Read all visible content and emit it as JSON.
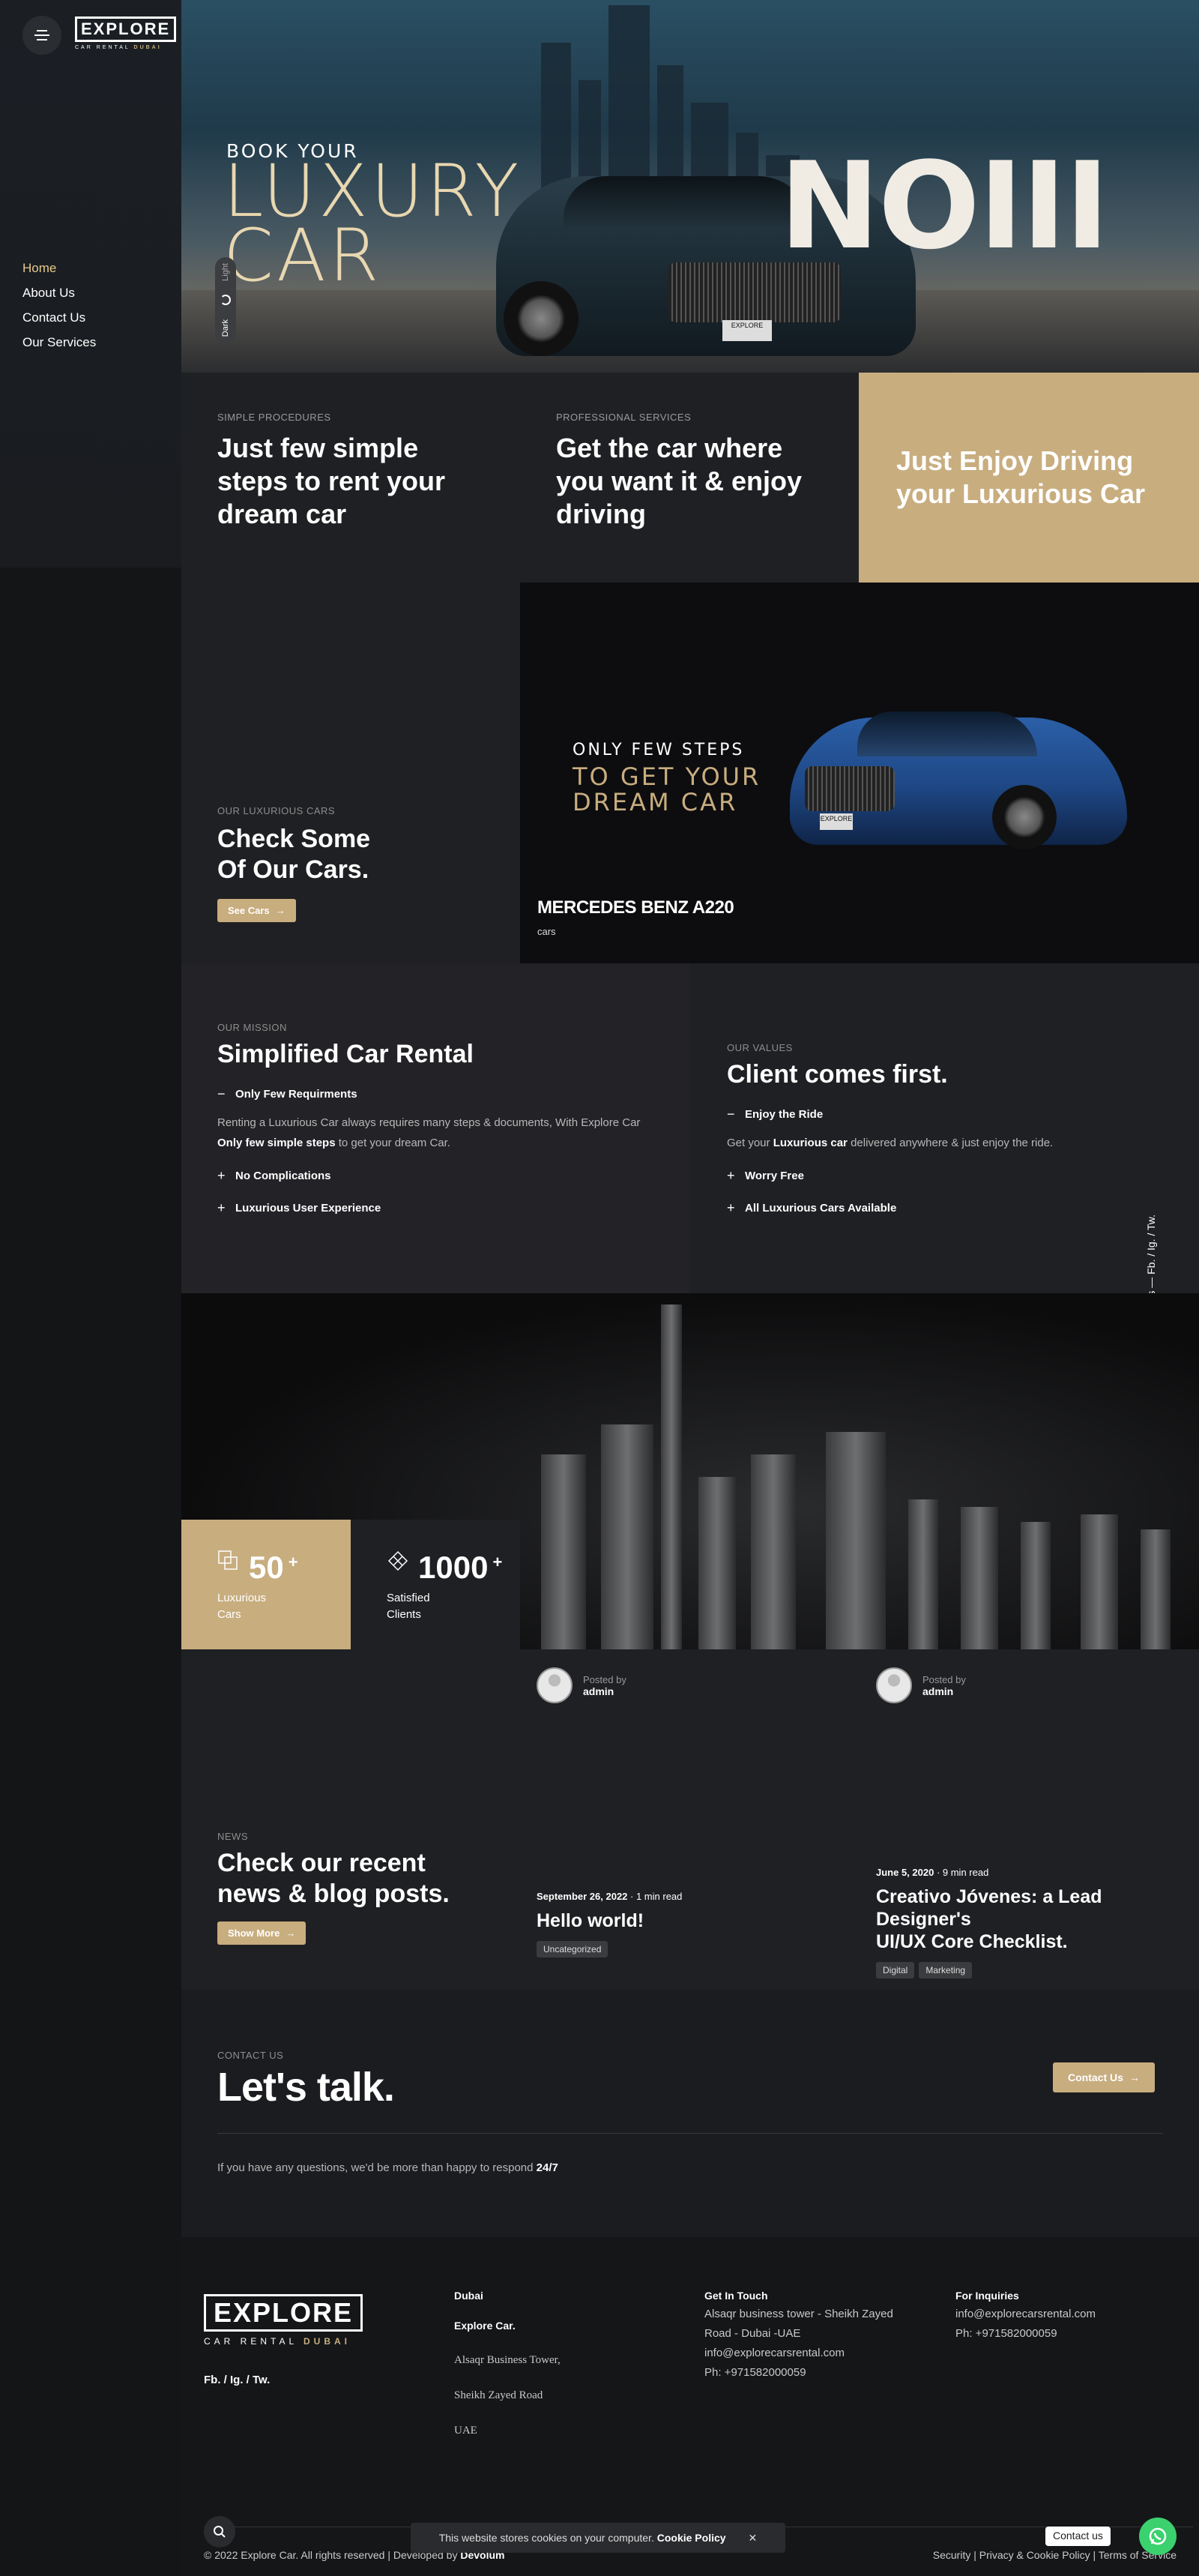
{
  "brand": {
    "logo": "EXPLORE",
    "tagline_prefix": "CAR RENTAL ",
    "tagline_city": "DUBAI"
  },
  "nav": [
    "Home",
    "About Us",
    "Contact Us",
    "Our Services"
  ],
  "mode_toggle": {
    "dark": "Dark",
    "light": "Light"
  },
  "hero": {
    "eyebrow": "BOOK YOUR",
    "title_line1": "LUXURY",
    "title_line2": "CAR",
    "model": "NOIII",
    "plate": "EXPLORE"
  },
  "steps": [
    {
      "eyebrow": "SIMPLE PROCEDURES",
      "title": "Just few simple steps to rent your dream car"
    },
    {
      "eyebrow": "PROFESSIONAL SERVICES",
      "title": "Get the car where you want it & enjoy driving"
    }
  ],
  "gold_cta": "Just Enjoy Driving your Luxurious Car",
  "cars": {
    "eyebrow": "OUR LUXURIOUS CARS",
    "title_line1": "Check Some",
    "title_line2": "Of Our Cars.",
    "button": "See Cars",
    "promo_small": "ONLY FEW STEPS",
    "promo_line1": "TO GET YOUR",
    "promo_line2": "DREAM CAR",
    "car_name": "MERCEDES BENZ A220",
    "car_category": "cars"
  },
  "mission": {
    "eyebrow": "OUR MISSION",
    "title": "Simplified Car Rental",
    "open_item": "Only Few Requirments",
    "para_1": "Renting a Luxurious Car always requires many steps & documents, With Explore Car ",
    "para_bold": "Only few simple steps",
    "para_2": " to get your dream Car.",
    "items": [
      "No Complications",
      "Luxurious User Experience"
    ]
  },
  "values": {
    "eyebrow": "OUR VALUES",
    "title": "Client comes first.",
    "open_item": "Enjoy the Ride",
    "para_1": "Get your ",
    "para_bold": "Luxurious car",
    "para_2": " delivered anywhere & just enjoy the ride.",
    "items": [
      "Worry Free",
      "All Luxurious Cars Available"
    ]
  },
  "follow": "Follow Us — Fb. / Ig. / Tw.",
  "stats": [
    {
      "number": "50",
      "plus": "+",
      "label_line1": "Luxurious",
      "label_line2": "Cars",
      "icon": "cars-icon"
    },
    {
      "number": "1000",
      "plus": "+",
      "label_line1": "Satisfied",
      "label_line2": "Clients",
      "icon": "diamond-icon"
    }
  ],
  "news": {
    "eyebrow": "NEWS",
    "title_line1": "Check our recent",
    "title_line2": "news & blog posts.",
    "button": "Show More",
    "posts": [
      {
        "posted_by": "Posted by",
        "author": "admin",
        "date": "September 26, 2022",
        "read": " · 1 min read",
        "title_line1": "Hello world!",
        "title_line2": "",
        "tags": [
          "Uncategorized"
        ]
      },
      {
        "posted_by": "Posted by",
        "author": "admin",
        "date": "June 5, 2020",
        "read": " · 9 min read",
        "title_line1": "Creativo Jóvenes: a Lead Designer's",
        "title_line2": "UI/UX Core Checklist.",
        "tags": [
          "Digital",
          "Marketing"
        ]
      }
    ]
  },
  "contact": {
    "eyebrow": "CONTACT US",
    "title": "Let's talk.",
    "button": "Contact Us",
    "note": "If you have any questions, we'd be more than happy to respond ",
    "note_bold": "24/7"
  },
  "footer": {
    "socials": "Fb. /  Ig. /  Tw.",
    "col1": {
      "head": "Dubai",
      "company": "Explore Car.",
      "lines": [
        "Alsaqr Business Tower,",
        "Sheikh Zayed Road",
        "UAE"
      ]
    },
    "col2": {
      "head": "Get In Touch",
      "addr1": "Alsaqr business tower - Sheikh Zayed",
      "addr2": "Road - Dubai -UAE",
      "email": "info@explorecarsrental.com",
      "phone": "Ph: +971582000059"
    },
    "col3": {
      "head": "For Inquiries",
      "email": "info@explorecarsrental.com",
      "phone": "Ph: +971582000059"
    },
    "copyright": "© 2022 Explore Car. All rights reserved | Developed by ",
    "developer": "Devolum",
    "legal": "Security | Privacy & Cookie Policy | Terms of Service"
  },
  "cookie": {
    "text": "This website stores cookies on your computer. ",
    "link": "Cookie Policy",
    "close": "✕"
  },
  "whatsapp": {
    "label": "Contact us"
  },
  "colors": {
    "gold": "#c8ad7f",
    "nav_active": "#e7c98a",
    "whatsapp": "#3bd16f"
  }
}
